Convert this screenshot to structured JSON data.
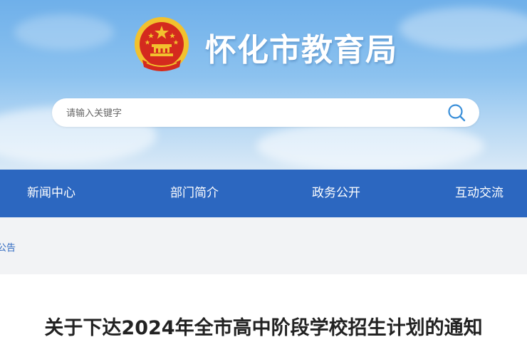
{
  "header": {
    "site_title": "怀化市教育局",
    "emblem_icon": "national-emblem-icon"
  },
  "search": {
    "placeholder": "请输入关键字",
    "icon": "search-icon"
  },
  "nav": {
    "items": [
      {
        "label": "新闻中心"
      },
      {
        "label": "部门简介"
      },
      {
        "label": "政务公开"
      },
      {
        "label": "互动交流"
      }
    ]
  },
  "breadcrumb": {
    "current": "公告"
  },
  "article": {
    "title": "关于下达2024年全市高中阶段学校招生计划的通知"
  },
  "colors": {
    "nav_bg": "#2c67c0",
    "emblem_red": "#d42a1e",
    "emblem_gold": "#f2c12e",
    "search_icon": "#3a8fd9"
  }
}
